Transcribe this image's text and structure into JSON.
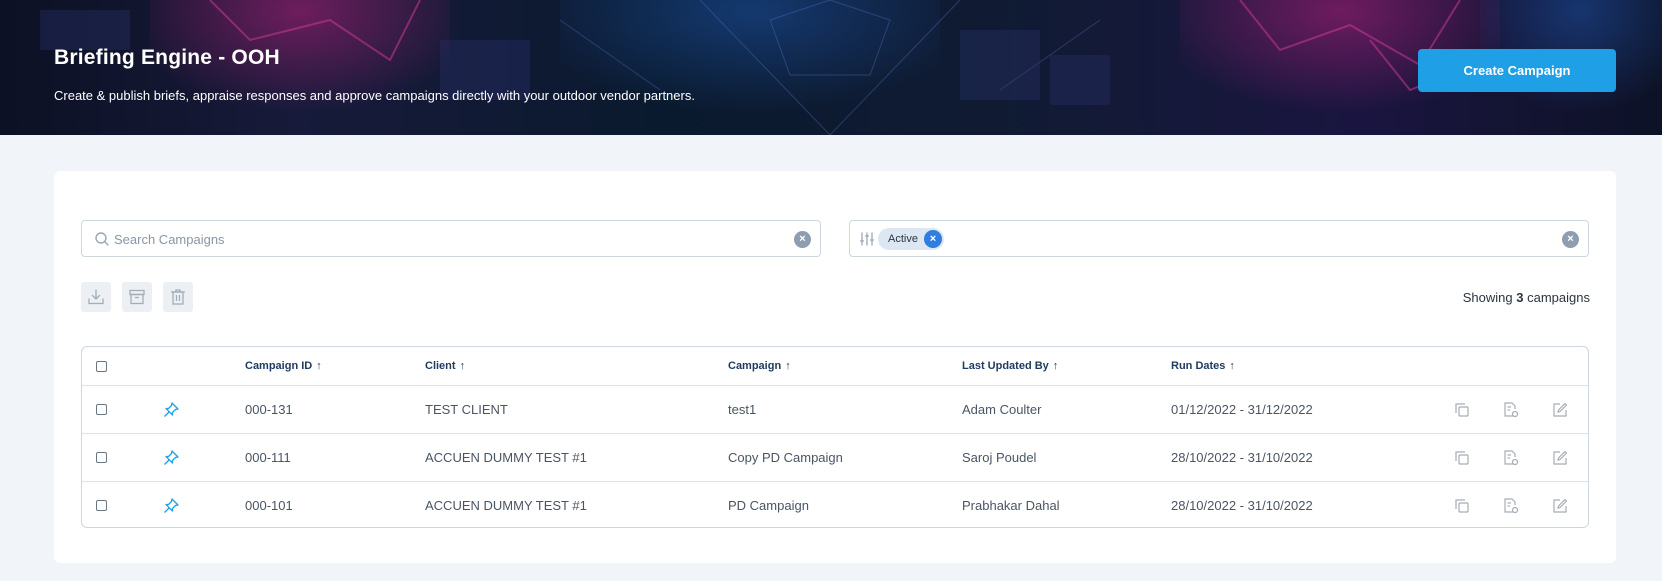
{
  "header": {
    "title": "Briefing Engine - OOH",
    "subtitle": "Create & publish briefs, appraise responses and approve campaigns directly with your outdoor vendor partners.",
    "create_button": "Create Campaign"
  },
  "search": {
    "placeholder": "Search Campaigns",
    "value": ""
  },
  "filter": {
    "chips": [
      "Active"
    ]
  },
  "toolbar": {
    "icons": [
      "download-icon",
      "archive-icon",
      "trash-icon"
    ]
  },
  "summary": {
    "prefix": "Showing",
    "count": "3",
    "suffix": "campaigns"
  },
  "table": {
    "columns": [
      "Campaign ID",
      "Client",
      "Campaign",
      "Last Updated By",
      "Run Dates"
    ],
    "sort_indicator": "↑",
    "rows": [
      {
        "id": "000-131",
        "client": "TEST CLIENT",
        "campaign": "test1",
        "updated_by": "Adam Coulter",
        "run_dates": "01/12/2022 - 31/12/2022"
      },
      {
        "id": "000-111",
        "client": "ACCUEN DUMMY TEST #1",
        "campaign": "Copy PD Campaign",
        "updated_by": "Saroj Poudel",
        "run_dates": "28/10/2022 - 31/10/2022"
      },
      {
        "id": "000-101",
        "client": "ACCUEN DUMMY TEST #1",
        "campaign": "PD Campaign",
        "updated_by": "Prabhakar Dahal",
        "run_dates": "28/10/2022 - 31/10/2022"
      }
    ],
    "row_icons": [
      "pin-icon",
      "copy-icon",
      "document-settings-icon",
      "edit-icon"
    ]
  },
  "colors": {
    "accent": "#1e9fe6",
    "chip_close": "#2f7de1",
    "pin": "#1e9fe6",
    "header_text": "#1e3a5f"
  }
}
